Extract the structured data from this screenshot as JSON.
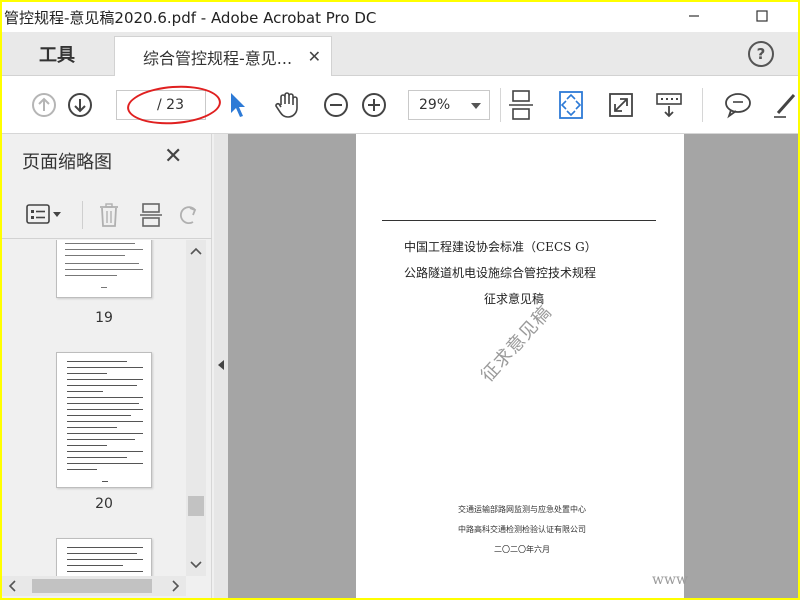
{
  "titlebar": {
    "title": "管控规程-意见稿2020.6.pdf - Adobe Acrobat Pro DC"
  },
  "tabs": {
    "tools_label": "工具",
    "document_tab_label": "综合管控规程-意见...",
    "help_label": "?"
  },
  "toolbar": {
    "page_current": "",
    "page_total": "/ 23",
    "zoom_value": "29%"
  },
  "sidebar": {
    "title": "页面缩略图",
    "thumbnails": [
      {
        "number": "19"
      },
      {
        "number": "20"
      }
    ]
  },
  "document": {
    "heading_line1": "中国工程建设协会标准（CECS G）",
    "heading_line2": "公路隧道机电设施综合管控技术规程",
    "heading_line3": "征求意见稿",
    "watermark": "征求意见稿",
    "footer_line1": "交通运输部路网监测与应急处置中心",
    "footer_line2": "中路高科交通检测检验认证有限公司",
    "footer_date": "二〇二〇年六月"
  },
  "overlay_text": "www",
  "colors": {
    "accent_blue": "#2d7ad6",
    "highlight_red": "#e02020",
    "screen_border_yellow": "#ffff00",
    "doc_background": "#a5a5a5"
  }
}
